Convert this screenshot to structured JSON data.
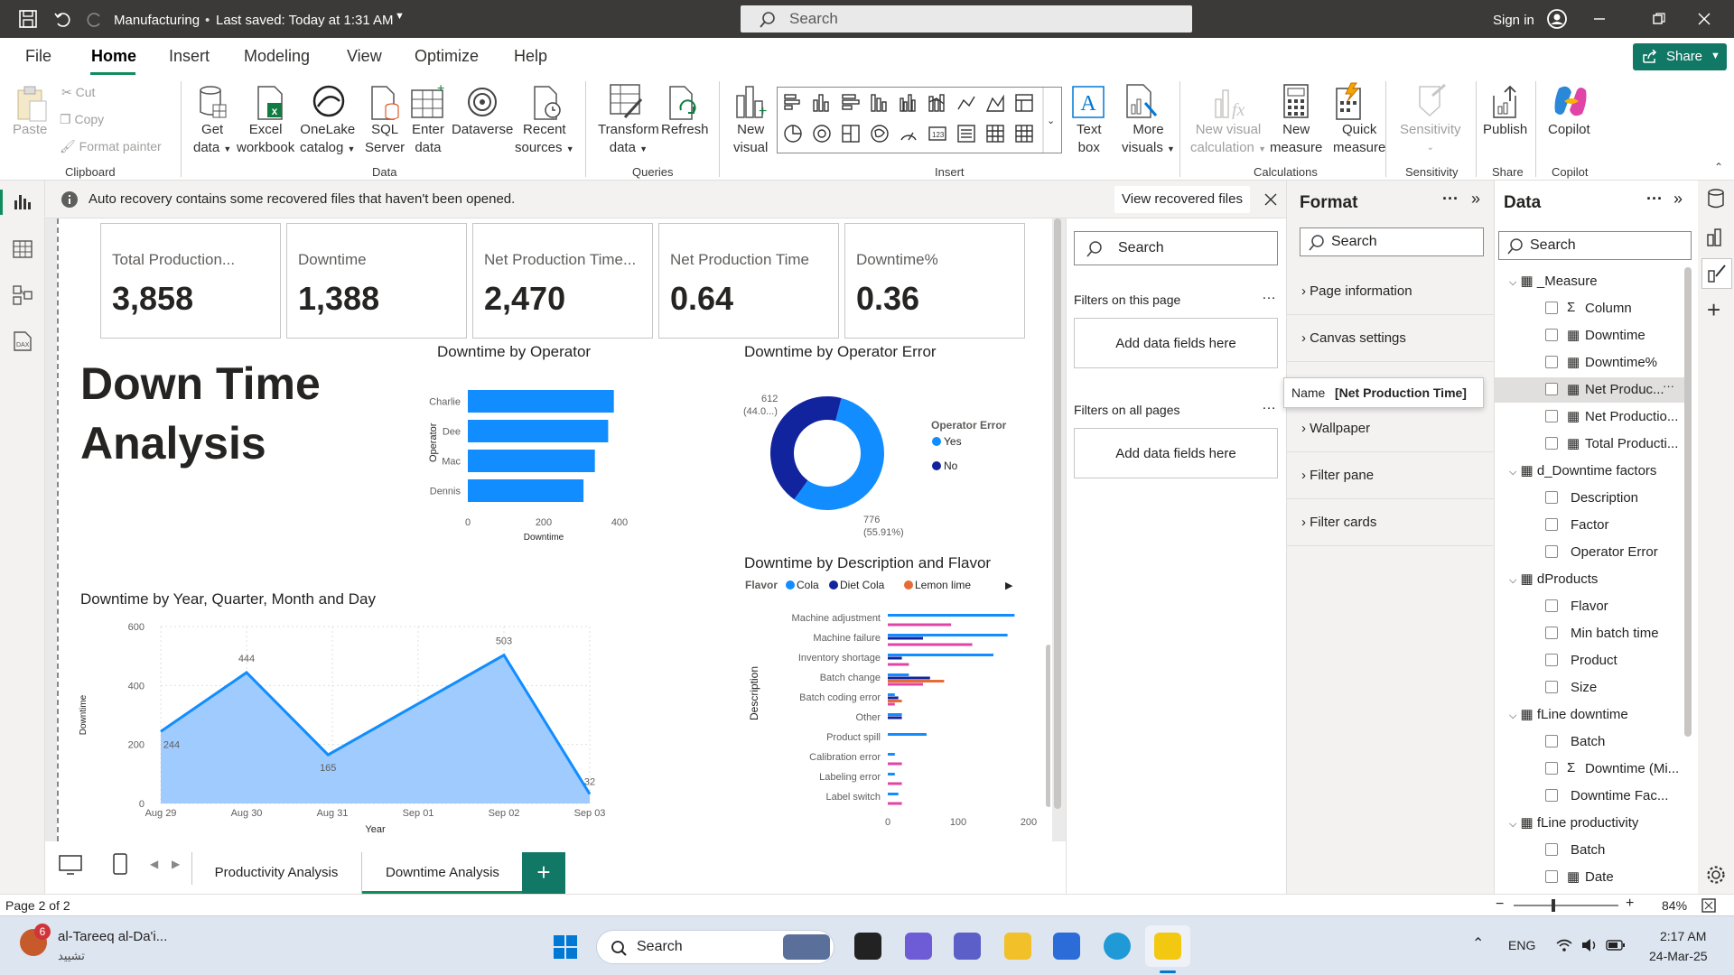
{
  "titlebar": {
    "doc_name": "Manufacturing",
    "saved": "Last saved: Today at 1:31 AM",
    "search": "Search",
    "sign_in": "Sign in"
  },
  "menu": {
    "items": [
      "File",
      "Home",
      "Insert",
      "Modeling",
      "View",
      "Optimize",
      "Help"
    ],
    "share": "Share"
  },
  "ribbon": {
    "clipboard": {
      "paste": "Paste",
      "cut": "Cut",
      "copy": "Copy",
      "format_painter": "Format painter",
      "group": "Clipboard"
    },
    "data": {
      "get_data": [
        "Get",
        "data"
      ],
      "excel": [
        "Excel",
        "workbook"
      ],
      "onelake": [
        "OneLake",
        "catalog"
      ],
      "sql": [
        "SQL",
        "Server"
      ],
      "enter": [
        "Enter",
        "data"
      ],
      "dataverse": "Dataverse",
      "recent": [
        "Recent",
        "sources"
      ],
      "group": "Data"
    },
    "queries": {
      "transform": [
        "Transform",
        "data"
      ],
      "refresh": "Refresh",
      "group": "Queries"
    },
    "insert": {
      "new_visual": [
        "New",
        "visual"
      ],
      "text_box": [
        "Text",
        "box"
      ],
      "more_visuals": [
        "More",
        "visuals"
      ],
      "group": "Insert"
    },
    "calculations": {
      "new_visual_calc": [
        "New visual",
        "calculation"
      ],
      "new_measure": [
        "New",
        "measure"
      ],
      "quick_measure": [
        "Quick",
        "measure"
      ],
      "group": "Calculations"
    },
    "sensitivity": {
      "label": "Sensitivity",
      "group": "Sensitivity"
    },
    "share": {
      "publish": "Publish",
      "group": "Share"
    },
    "copilot": {
      "label": "Copilot",
      "group": "Copilot"
    }
  },
  "notification": {
    "text": "Auto recovery contains some recovered files that haven't been opened.",
    "button": "View recovered files"
  },
  "cards": [
    {
      "label": "Total Production...",
      "value": "3,858"
    },
    {
      "label": "Downtime",
      "value": "1,388"
    },
    {
      "label": "Net Production Time...",
      "value": "2,470"
    },
    {
      "label": "Net Production Time",
      "value": "0.64"
    },
    {
      "label": "Downtime%",
      "value": "0.36"
    }
  ],
  "report_title": [
    "Down Time",
    "Analysis"
  ],
  "charts": {
    "operator": {
      "title": "Downtime by Operator",
      "ylabel": "Operator",
      "xlabel": "Downtime",
      "ticks": [
        "0",
        "200",
        "400"
      ]
    },
    "operator_error": {
      "title": "Downtime by Operator Error",
      "legend_title": "Operator Error",
      "label_no": "612",
      "label_no_pct": "(44.0...)",
      "label_yes": "776",
      "label_yes_pct": "(55.91%)"
    },
    "timeline": {
      "title": "Downtime by Year, Quarter, Month and Day",
      "ylabel": "Downtime",
      "xlabel": "Year",
      "yticks": [
        "600",
        "400",
        "200",
        "0"
      ]
    },
    "description": {
      "title": "Downtime by Description and Flavor",
      "legend_title": "Flavor",
      "ylabel": "Description",
      "xticks": [
        "0",
        "100",
        "200"
      ]
    }
  },
  "chart_data": [
    {
      "type": "bar",
      "title": "Downtime by Operator",
      "orientation": "horizontal",
      "categories": [
        "Charlie",
        "Dee",
        "Mac",
        "Dennis"
      ],
      "values": [
        385,
        370,
        335,
        305
      ],
      "xlim": [
        0,
        400
      ],
      "xlabel": "Downtime",
      "ylabel": "Operator",
      "color": "#118dff"
    },
    {
      "type": "pie",
      "title": "Downtime by Operator Error",
      "donut": true,
      "categories": [
        "Yes",
        "No"
      ],
      "values": [
        776,
        612
      ],
      "colors": [
        "#118dff",
        "#12239e"
      ],
      "legend_title": "Operator Error"
    },
    {
      "type": "area",
      "title": "Downtime by Year, Quarter, Month and Day",
      "categories": [
        "Aug 29",
        "Aug 30",
        "Aug 31",
        "Sep 01",
        "Sep 02",
        "Sep 03"
      ],
      "x_positions": [
        0,
        1,
        2,
        3,
        4,
        5
      ],
      "points": [
        {
          "x": 0,
          "y": 244
        },
        {
          "x": 1,
          "y": 444
        },
        {
          "x": 1.95,
          "y": 165
        },
        {
          "x": 4,
          "y": 503
        },
        {
          "x": 5,
          "y": 32
        }
      ],
      "ylim": [
        0,
        600
      ],
      "xlabel": "Year",
      "ylabel": "Downtime"
    },
    {
      "type": "bar",
      "title": "Downtime by Description and Flavor",
      "orientation": "horizontal",
      "categories": [
        "Machine adjustment",
        "Machine failure",
        "Inventory shortage",
        "Batch change",
        "Batch coding error",
        "Other",
        "Product spill",
        "Calibration error",
        "Labeling error",
        "Label switch"
      ],
      "series": [
        {
          "name": "Cola",
          "color": "#118dff",
          "values": [
            180,
            170,
            150,
            30,
            10,
            20,
            55,
            10,
            10,
            15
          ]
        },
        {
          "name": "Diet Cola",
          "color": "#12239e",
          "values": [
            0,
            50,
            20,
            60,
            15,
            20,
            0,
            0,
            0,
            0
          ]
        },
        {
          "name": "Lemon lime",
          "color": "#e66c37",
          "values": [
            0,
            0,
            0,
            80,
            20,
            0,
            0,
            0,
            0,
            0
          ]
        },
        {
          "name": "",
          "color": "#e044a7",
          "values": [
            90,
            120,
            30,
            50,
            10,
            0,
            0,
            20,
            20,
            20
          ]
        }
      ],
      "xlim": [
        0,
        200
      ],
      "ylabel": "Description",
      "legend_title": "Flavor"
    }
  ],
  "filters": {
    "search": "Search",
    "this_page": "Filters on this page",
    "all_pages": "Filters on all pages",
    "add": "Add data fields here"
  },
  "format": {
    "title": "Format",
    "search": "Search",
    "items": [
      "Page information",
      "Canvas settings",
      "Wallpaper",
      "Filter pane",
      "Filter cards"
    ],
    "tooltip_key": "Name",
    "tooltip_val": "[Net Production Time]"
  },
  "data_pane": {
    "title": "Data",
    "search": "Search",
    "tables": [
      {
        "name": "_Measure",
        "fields": [
          "Column",
          "Downtime",
          "Downtime%",
          "Net Produc...",
          "Net Productio...",
          "Total Producti..."
        ]
      },
      {
        "name": "d_Downtime factors",
        "fields": [
          "Description",
          "Factor",
          "Operator Error"
        ]
      },
      {
        "name": "dProducts",
        "fields": [
          "Flavor",
          "Min batch time",
          "Product",
          "Size"
        ]
      },
      {
        "name": "fLine downtime",
        "fields": [
          "Batch",
          "Downtime (Mi...",
          "Downtime Fac..."
        ]
      },
      {
        "name": "fLine productivity",
        "fields": [
          "Batch",
          "Date"
        ]
      }
    ]
  },
  "tabs": [
    "Productivity Analysis",
    "Downtime Analysis"
  ],
  "status": {
    "page": "Page 2 of 2",
    "zoom": "84%"
  },
  "taskbar": {
    "app": "al-Tareeq al-Da'i...",
    "app_sub": "تشييد",
    "badge": "6",
    "search": "Search",
    "lang": "ENG",
    "time": "2:17 AM",
    "date": "24-Mar-25"
  },
  "colors": {
    "accent": "#118dff",
    "dark_blue": "#12239e",
    "orange": "#e66c37",
    "pink": "#e044a7",
    "green": "#117865"
  }
}
